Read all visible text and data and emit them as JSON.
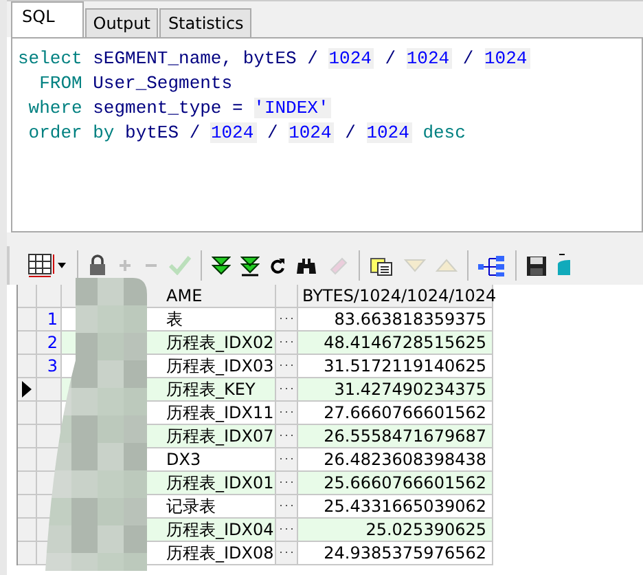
{
  "tabs": [
    {
      "label": "SQL",
      "selected": true
    },
    {
      "label": "Output",
      "selected": false
    },
    {
      "label": "Statistics",
      "selected": false
    }
  ],
  "editor": {
    "lines": [
      [
        {
          "kind": "keyword",
          "text": "select"
        },
        {
          "kind": "ident",
          "text": " sEGMENT_name, bytES / "
        },
        {
          "kind": "number",
          "text": "1024"
        },
        {
          "kind": "ident",
          "text": " / "
        },
        {
          "kind": "number",
          "text": "1024"
        },
        {
          "kind": "ident",
          "text": " / "
        },
        {
          "kind": "number",
          "text": "1024"
        }
      ],
      [
        {
          "kind": "keyword",
          "text": "  FROM"
        },
        {
          "kind": "ident",
          "text": " User_Segments"
        }
      ],
      [
        {
          "kind": "keyword",
          "text": " where"
        },
        {
          "kind": "ident",
          "text": " segment_type = "
        },
        {
          "kind": "number",
          "text": "'INDEX'"
        }
      ],
      [
        {
          "kind": "keyword",
          "text": " order by"
        },
        {
          "kind": "ident",
          "text": " bytES / "
        },
        {
          "kind": "number",
          "text": "1024"
        },
        {
          "kind": "ident",
          "text": " / "
        },
        {
          "kind": "number",
          "text": "1024"
        },
        {
          "kind": "ident",
          "text": " / "
        },
        {
          "kind": "number",
          "text": "1024"
        },
        {
          "kind": "keyword",
          "text": " desc"
        }
      ]
    ]
  },
  "toolbar": [
    {
      "kind": "grid",
      "disabled": false
    },
    {
      "kind": "lock",
      "disabled": false
    },
    {
      "kind": "plus",
      "disabled": true
    },
    {
      "kind": "minus",
      "disabled": true
    },
    {
      "kind": "check",
      "disabled": true
    },
    {
      "kind": "next",
      "disabled": false
    },
    {
      "kind": "last",
      "disabled": false
    },
    {
      "kind": "refresh",
      "disabled": false
    },
    {
      "kind": "find",
      "disabled": false
    },
    {
      "kind": "eraser",
      "disabled": true
    },
    {
      "kind": "notes",
      "disabled": false
    },
    {
      "kind": "down",
      "disabled": true
    },
    {
      "kind": "up",
      "disabled": true
    },
    {
      "kind": "tree",
      "disabled": false
    },
    {
      "kind": "save",
      "disabled": false
    },
    {
      "kind": "db",
      "disabled": false
    }
  ],
  "grid": {
    "columns": [
      "AME",
      "BYTES/1024/1024/1024"
    ],
    "rows": [
      {
        "number": "1",
        "name": "表",
        "value": "83.663818359375",
        "current": false
      },
      {
        "number": "2",
        "name": "历程表_IDX02",
        "value": "48.4146728515625",
        "current": false
      },
      {
        "number": "3",
        "name": "历程表_IDX03",
        "value": "31.5172119140625",
        "current": false
      },
      {
        "name": "历程表_KEY",
        "value": "31.427490234375",
        "current": true
      },
      {
        "name": "历程表_IDX11",
        "value": "27.6660766601562",
        "current": false
      },
      {
        "name": "历程表_IDX07",
        "value": "26.5558471679687",
        "current": false
      },
      {
        "name": "DX3",
        "value": "26.4823608398438",
        "current": false
      },
      {
        "name": "历程表_IDX01",
        "value": "25.6660766601562",
        "current": false
      },
      {
        "name": "记录表",
        "value": "25.4331665039062",
        "current": false
      },
      {
        "name": "历程表_IDX04",
        "value": "25.025390625",
        "current": false
      },
      {
        "name": "历程表_IDX08",
        "value": "24.9385375976562",
        "current": false
      }
    ]
  }
}
